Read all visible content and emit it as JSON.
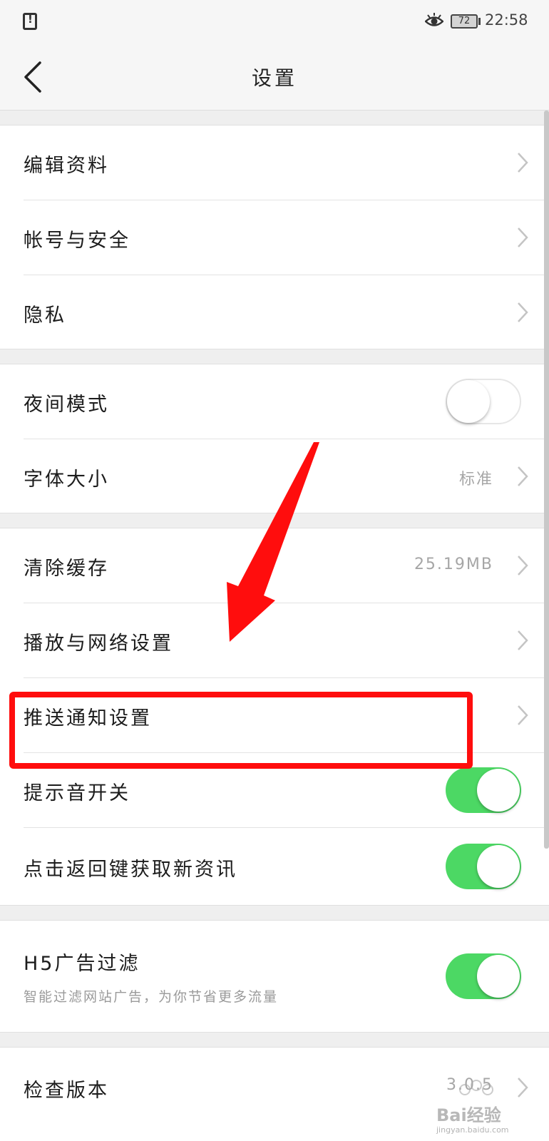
{
  "status_bar": {
    "left_icon": "sim-alert-icon",
    "eye_icon": "eye-icon",
    "battery": "72",
    "time": "22:58"
  },
  "header": {
    "back_icon": "back-chevron-icon",
    "title": "设置"
  },
  "groups": [
    {
      "items": [
        {
          "label": "编辑资料",
          "control": "chevron"
        },
        {
          "label": "帐号与安全",
          "control": "chevron"
        },
        {
          "label": "隐私",
          "control": "chevron"
        }
      ]
    },
    {
      "items": [
        {
          "label": "夜间模式",
          "control": "toggle",
          "on": false
        },
        {
          "label": "字体大小",
          "value": "标准",
          "control": "chevron"
        }
      ]
    },
    {
      "items": [
        {
          "label": "清除缓存",
          "value": "25.19MB",
          "control": "chevron"
        },
        {
          "label": "播放与网络设置",
          "control": "chevron"
        },
        {
          "label": "推送通知设置",
          "control": "chevron"
        },
        {
          "label": "提示音开关",
          "control": "toggle",
          "on": true
        },
        {
          "label": "点击返回键获取新资讯",
          "control": "toggle",
          "on": true
        }
      ]
    },
    {
      "items": [
        {
          "label": "H5广告过滤",
          "sublabel": "智能过滤网站广告，为你节省更多流量",
          "control": "toggle",
          "on": true
        }
      ]
    },
    {
      "items": [
        {
          "label": "检查版本",
          "value": "3.0.5",
          "control": "chevron"
        }
      ]
    }
  ],
  "colors": {
    "toggle_on": "#4cd864",
    "annotation": "#ff0d0d",
    "background": "#efefef"
  },
  "watermark": {
    "text": "Bai经验",
    "url": "jingyan.baidu.com"
  }
}
